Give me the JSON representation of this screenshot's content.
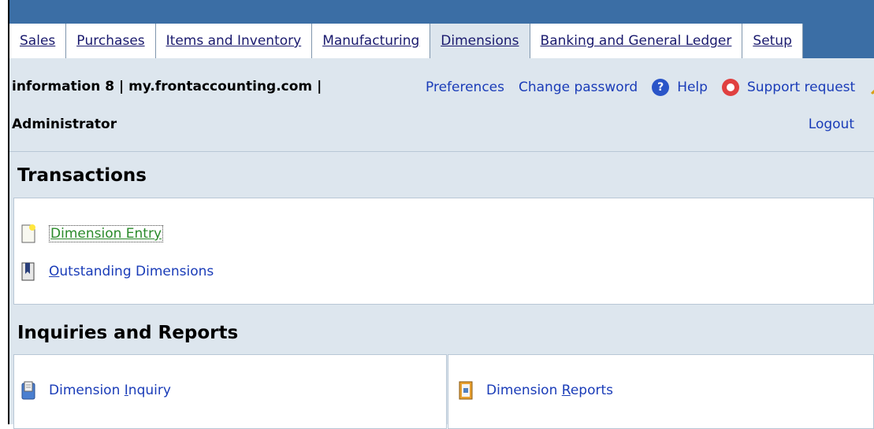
{
  "tabs": [
    {
      "label": "Sales",
      "access": "S",
      "rest": "ales"
    },
    {
      "label": "Purchases",
      "access": "P",
      "rest": "urchases"
    },
    {
      "label": "Items and Inventory",
      "access": "I",
      "rest": "tems and Inventory"
    },
    {
      "label": "Manufacturing",
      "access": "M",
      "rest": "anufacturing"
    },
    {
      "label": "Dimensions",
      "access": "D",
      "rest": "imensions"
    },
    {
      "label": "Banking and General Ledger",
      "access": "B",
      "rest": "anking and General Ledger"
    },
    {
      "label": "Setup",
      "access": "S",
      "rest": "etup"
    }
  ],
  "active_tab": "Dimensions",
  "header": {
    "company": "information 8 | my.frontaccounting.com |",
    "user": "Administrator",
    "preferences": "Preferences",
    "change_password": "Change password",
    "help": "Help",
    "support": "Support request",
    "logout": "Logout"
  },
  "transactions": {
    "title": "Transactions",
    "items": [
      {
        "pre": "",
        "access": "D",
        "rest": "imension Entry",
        "icon": "new-document-icon"
      },
      {
        "pre": "",
        "access": "O",
        "rest": "utstanding Dimensions",
        "icon": "bookmark-document-icon"
      }
    ]
  },
  "inquiries": {
    "title": "Inquiries and Reports",
    "left": {
      "pre": "Dimension ",
      "access": "I",
      "rest": "nquiry",
      "icon": "clipboard-icon"
    },
    "right": {
      "pre": "Dimension ",
      "access": "R",
      "rest": "eports",
      "icon": "report-icon"
    }
  },
  "colors": {
    "topbar": "#3b6ea5",
    "background": "#dde6ee",
    "link": "#1a3cb8",
    "visited_link": "#2a8a2a"
  }
}
